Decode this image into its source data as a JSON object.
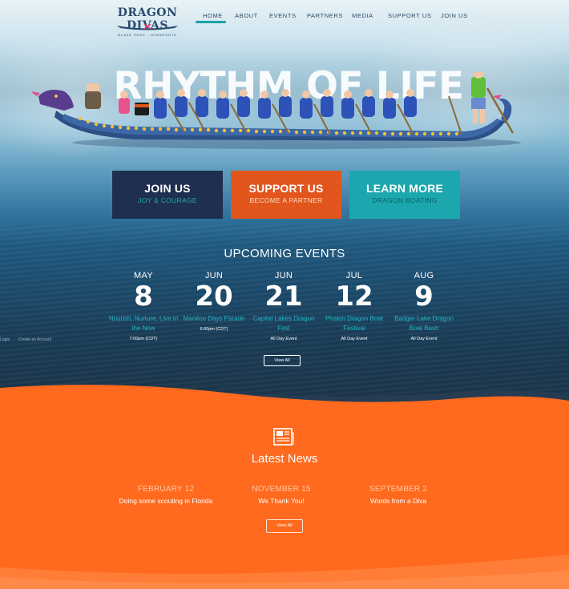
{
  "brand": {
    "name": "DRAGON DIVAS",
    "tagline": "BLAKE PARK  ·  MINNESOTA",
    "colors": {
      "navy": "#1f2f4f",
      "orange": "#e2561e",
      "teal": "#1ba7ad",
      "news_orange": "#ff6a1e"
    }
  },
  "nav": {
    "items": [
      {
        "label": "HOME",
        "active": true
      },
      {
        "label": "ABOUT"
      },
      {
        "label": "EVENTS"
      },
      {
        "label": "PARTNERS"
      },
      {
        "label": "MEDIA"
      },
      {
        "label": "SUPPORT US"
      },
      {
        "label": "JOIN US"
      }
    ]
  },
  "hero": {
    "title": "RHYTHM OF LIFE"
  },
  "cta": [
    {
      "title": "JOIN US",
      "subtitle": "JOY & COURAGE"
    },
    {
      "title": "SUPPORT US",
      "subtitle": "BECOME A PARTNER"
    },
    {
      "title": "LEARN MORE",
      "subtitle": "DRAGON BOATING"
    }
  ],
  "events": {
    "heading": "UPCOMING EVENTS",
    "items": [
      {
        "month": "MAY",
        "day": "8",
        "name": "Nourish, Nurture, Live in the Now",
        "time": "7:00pm (CDT)"
      },
      {
        "month": "JUN",
        "day": "20",
        "name": "Manitou Days Parade",
        "time": "6:00pm (CDT)"
      },
      {
        "month": "JUN",
        "day": "21",
        "name": "Capital Lakes Dragon Fest",
        "time": "All Day Event"
      },
      {
        "month": "JUL",
        "day": "12",
        "name": "Phalen Dragon Boat Festival",
        "time": "All Day Event"
      },
      {
        "month": "AUG",
        "day": "9",
        "name": "Badger Lake Dragon Boat Bash",
        "time": "All Day Event"
      }
    ],
    "view_all": "View All"
  },
  "account": {
    "login": "Login",
    "create": "Create an Account"
  },
  "news": {
    "icon": "newspaper-icon",
    "heading": "Latest News",
    "items": [
      {
        "date": "FEBRUARY 12",
        "headline": "Doing some scouting in Florida"
      },
      {
        "date": "NOVEMBER 15",
        "headline": "We Thank You!"
      },
      {
        "date": "SEPTEMBER 2",
        "headline": "Words from a Diva"
      }
    ],
    "view_all": "View All"
  }
}
